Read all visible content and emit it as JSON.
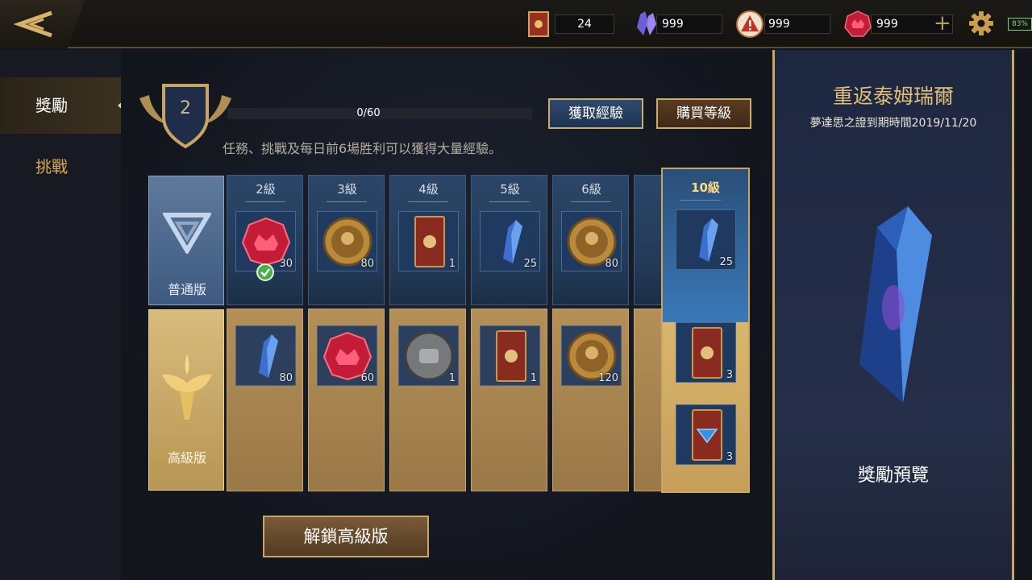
{
  "topbar": {
    "resources": [
      {
        "icon": "card-icon",
        "value": "24"
      },
      {
        "icon": "crystal-icon",
        "value": "999"
      },
      {
        "icon": "warning-emblem-icon",
        "value": "999"
      },
      {
        "icon": "ruby-icon",
        "value": "999"
      }
    ],
    "add_label": "+",
    "battery": "83%"
  },
  "nav": {
    "items": [
      {
        "label": "獎勵",
        "active": true
      },
      {
        "label": "挑戰",
        "active": false
      }
    ]
  },
  "pass": {
    "level": "2",
    "xp": "0/60",
    "hint": "任務、挑戰及每日前6場胜利可以獲得大量經驗。",
    "get_xp_button": "獲取經驗",
    "buy_level_button": "購買等級",
    "normal_track_label": "普通版",
    "premium_track_label": "高級版",
    "unlock_button": "解鎖高級版",
    "levels": [
      {
        "label": "2級",
        "normal": {
          "item": "ruby",
          "qty": "30",
          "claimed": true
        },
        "premium": {
          "item": "crystal",
          "qty": "80"
        }
      },
      {
        "label": "3級",
        "normal": {
          "item": "coin",
          "qty": "80"
        },
        "premium": {
          "item": "ruby",
          "qty": "60"
        }
      },
      {
        "label": "4級",
        "normal": {
          "item": "card",
          "qty": "1"
        },
        "premium": {
          "item": "silver-coin",
          "qty": "1"
        }
      },
      {
        "label": "5級",
        "normal": {
          "item": "crystal",
          "qty": "25"
        },
        "premium": {
          "item": "card",
          "qty": "1"
        }
      },
      {
        "label": "6級",
        "normal": {
          "item": "coin",
          "qty": "80"
        },
        "premium": {
          "item": "coin",
          "qty": "120"
        }
      }
    ],
    "highlight": {
      "label": "10級",
      "normal": {
        "item": "crystal",
        "qty": "25"
      },
      "premium": [
        {
          "item": "card",
          "qty": "3"
        },
        {
          "item": "card-blue",
          "qty": "3"
        }
      ]
    }
  },
  "preview": {
    "title": "重返泰姆瑞爾",
    "subtitle": "夢達思之證到期時間2019/11/20",
    "label": "獎勵預覽"
  },
  "colors": {
    "accent_gold": "#c9a560",
    "normal_blue": "#2a4668",
    "premium_gold": "#b48f57"
  }
}
